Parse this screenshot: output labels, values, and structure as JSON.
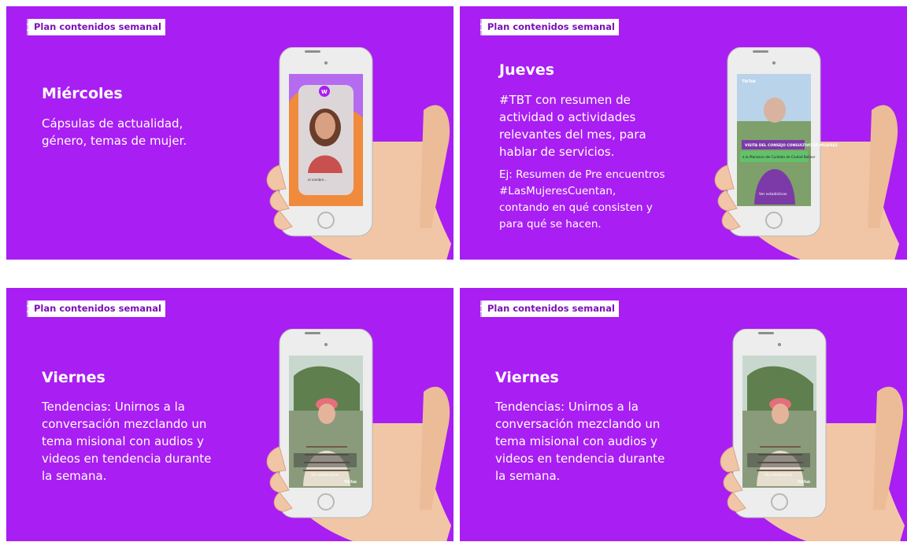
{
  "slides": [
    {
      "tag": "Plan contenidos semanal",
      "day": "Miércoles",
      "lines": [
        "Cápsulas de actualidad,",
        "género, temas de mujer."
      ],
      "example_lines": []
    },
    {
      "tag": "Plan contenidos semanal",
      "day": "Jueves",
      "lines": [
        "#TBT con resumen de",
        "actividad o actividades",
        "relevantes del mes, para",
        "hablar de servicios."
      ],
      "example_lines": [
        "Ej: Resumen de Pre encuentros",
        "#LasMujeresCuentan,",
        "contando en qué consisten y",
        "para qué se hacen."
      ]
    },
    {
      "tag": "Plan contenidos semanal",
      "day": "Viernes",
      "lines": [
        "Tendencias: Unirnos a la",
        "conversación mezclando un",
        "tema misional con audios y",
        "videos en tendencia durante",
        "la semana."
      ],
      "example_lines": []
    },
    {
      "tag": "Plan contenidos semanal",
      "day": "Viernes",
      "lines": [
        "Tendencias: Unirnos a la",
        "conversación mezclando un",
        "tema misional con audios y",
        "videos en tendencia durante",
        "la semana."
      ],
      "example_lines": []
    }
  ],
  "phones": {
    "tiktok_label": "TikTok",
    "stats_label": "Ver estadísticas",
    "jueves_banner_top": "VISITA DEL CONSEJO CONSULTIVO DE MUJERES",
    "jueves_banner_bottom": "a la Manzana del Cuidado de Ciudad Bolívar"
  },
  "colors": {
    "slide_bg": "#a91ef2",
    "tag_text": "#7a10b8",
    "text": "#ffffff"
  }
}
